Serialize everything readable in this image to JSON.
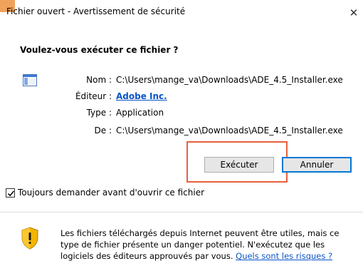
{
  "window": {
    "title": "Fichier ouvert - Avertissement de sécurité",
    "close_glyph": "✕"
  },
  "dialog": {
    "heading": "Voulez-vous exécuter ce fichier ?",
    "fields": {
      "name_label": "Nom :",
      "name_value": "C:\\Users\\mange_va\\Downloads\\ADE_4.5_Installer.exe",
      "publisher_label": "Éditeur :",
      "publisher_value": "Adobe Inc.",
      "type_label": "Type :",
      "type_value": "Application",
      "from_label": "De :",
      "from_value": "C:\\Users\\mange_va\\Downloads\\ADE_4.5_Installer.exe"
    },
    "buttons": {
      "run": "Exécuter",
      "cancel": "Annuler"
    },
    "checkbox": {
      "label": "Toujours demander avant d'ouvrir ce fichier",
      "checked": true
    },
    "warning": {
      "text": "Les fichiers téléchargés depuis Internet peuvent être utiles, mais ce type de fichier présente un danger potentiel. N'exécutez que les logiciels des éditeurs approuvés par vous.",
      "link": "Quels sont les risques ?"
    }
  },
  "colors": {
    "accent_blue": "#0078d7",
    "link_blue": "#0a55c9",
    "highlight_orange": "#e8603c",
    "title_tab_orange": "#f0a25a",
    "shield_yellow": "#f2b600"
  },
  "icons": {
    "app": "application-window-icon",
    "shield": "security-shield-icon",
    "check": "checkmark-icon",
    "close": "close-icon"
  }
}
